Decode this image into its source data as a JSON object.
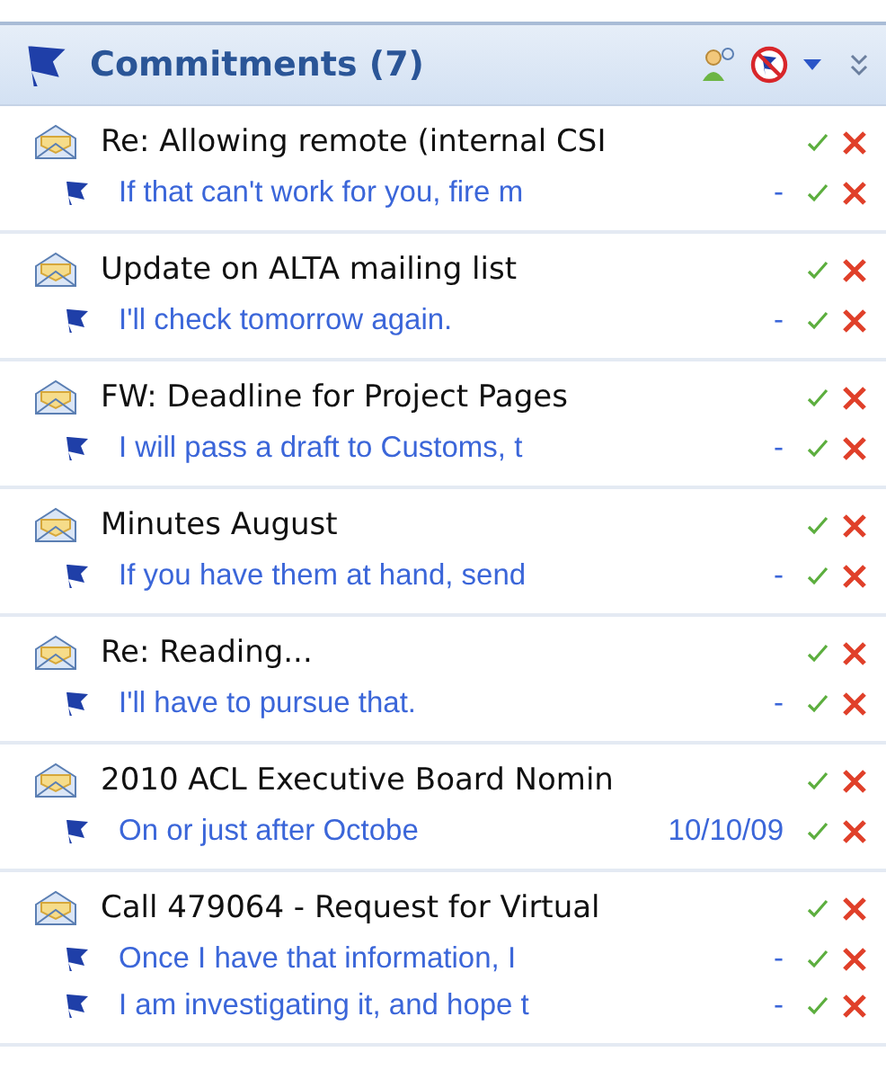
{
  "panel": {
    "title": "Commitments (7)"
  },
  "items": [
    {
      "subject": "Re: Allowing remote (internal CSI",
      "commitments": [
        {
          "text": "If that can't work for you, fire m",
          "due": "-"
        }
      ]
    },
    {
      "subject": "Update on ALTA mailing list",
      "commitments": [
        {
          "text": "I'll check tomorrow again.",
          "due": "-"
        }
      ]
    },
    {
      "subject": "FW: Deadline for Project Pages",
      "commitments": [
        {
          "text": "I will pass a draft to Customs, t",
          "due": "-"
        }
      ]
    },
    {
      "subject": "Minutes August",
      "commitments": [
        {
          "text": "If you have them at hand, send",
          "due": "-"
        }
      ]
    },
    {
      "subject": "Re: Reading...",
      "commitments": [
        {
          "text": "I'll have to pursue that.",
          "due": "-"
        }
      ]
    },
    {
      "subject": "2010 ACL Executive Board Nomin",
      "commitments": [
        {
          "text": "On or just after Octobe",
          "due": "10/10/09"
        }
      ]
    },
    {
      "subject": "Call 479064 - Request for Virtual",
      "commitments": [
        {
          "text": "Once I have that information, I",
          "due": "-"
        },
        {
          "text": "I am investigating it, and hope t",
          "due": "-"
        }
      ]
    }
  ]
}
